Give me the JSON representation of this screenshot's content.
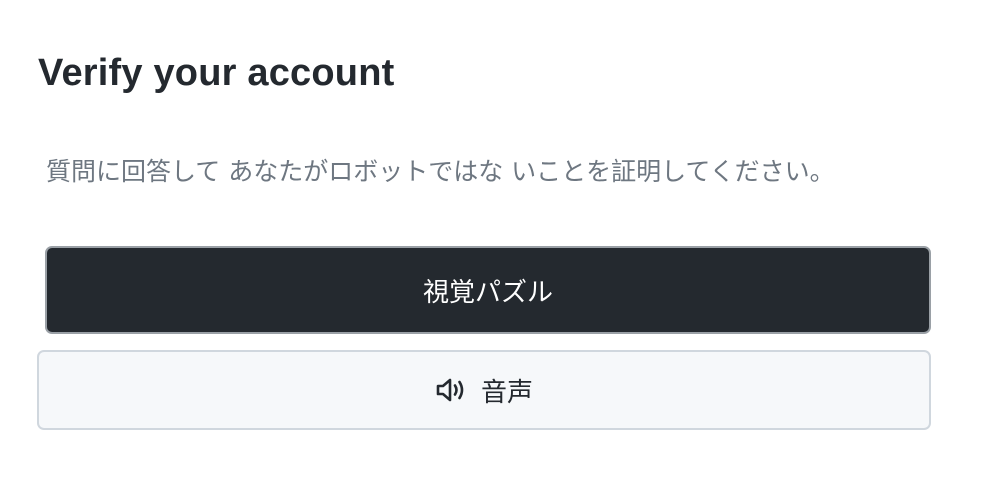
{
  "dialog": {
    "title": "Verify your account",
    "description": "質問に回答して あなたがロボットではな いことを証明してください。",
    "visual_button": {
      "label": "視覚パズル"
    },
    "audio_button": {
      "label": "音声",
      "icon": "speaker-icon"
    }
  },
  "colors": {
    "primary_bg": "#24292f",
    "secondary_bg": "#f6f8fa",
    "text_muted": "#6e7781"
  }
}
